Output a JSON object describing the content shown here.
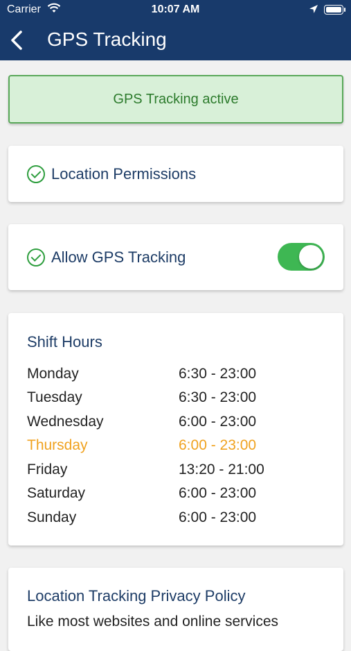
{
  "status_bar": {
    "carrier": "Carrier",
    "time": "10:07 AM"
  },
  "nav": {
    "title": "GPS Tracking"
  },
  "banner": {
    "text": "GPS Tracking active"
  },
  "permissions": {
    "label": "Location Permissions"
  },
  "gps_toggle": {
    "label": "Allow GPS Tracking",
    "enabled": true
  },
  "shift_hours": {
    "title": "Shift Hours",
    "rows": [
      {
        "day": "Monday",
        "time": "6:30 - 23:00"
      },
      {
        "day": "Tuesday",
        "time": "6:30 - 23:00"
      },
      {
        "day": "Wednesday",
        "time": "6:00 - 23:00"
      },
      {
        "day": "Thursday",
        "time": "6:00 - 23:00",
        "highlight": true
      },
      {
        "day": "Friday",
        "time": "13:20 - 21:00"
      },
      {
        "day": "Saturday",
        "time": "6:00 - 23:00"
      },
      {
        "day": "Sunday",
        "time": "6:00 - 23:00"
      }
    ]
  },
  "privacy": {
    "title": "Location Tracking Privacy Policy",
    "text": "Like most websites and online services"
  },
  "colors": {
    "header_bg": "#183a6b",
    "accent_green": "#3eb753",
    "highlight_orange": "#f0a21f"
  }
}
